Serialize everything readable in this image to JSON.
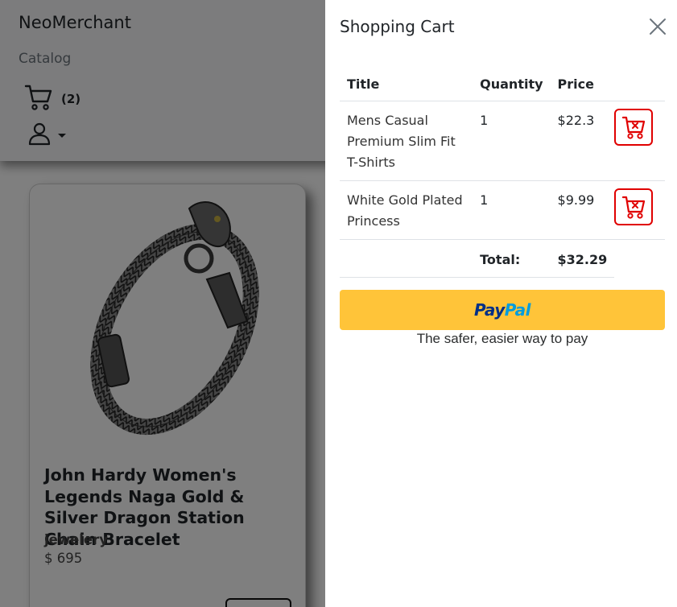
{
  "navbar": {
    "brand": "NeoMerchant",
    "catalog_link": "Catalog",
    "cart_count": "(2)",
    "cart_icon": "cart-icon",
    "user_icon": "user-icon"
  },
  "product": {
    "title": "John Hardy Women's Legends Naga Gold & Silver Dragon Station Chain Bracelet",
    "category": "jewelery",
    "price": "$ 695"
  },
  "cart": {
    "title": "Shopping Cart",
    "close_icon": "close-icon",
    "headers": {
      "title": "Title",
      "quantity": "Quantity",
      "price": "Price"
    },
    "items": [
      {
        "title": "Mens Casual Premium Slim Fit T-Shirts",
        "quantity": "1",
        "price": "$22.3",
        "remove_icon": "cart-remove-icon"
      },
      {
        "title": "White Gold Plated Princess",
        "quantity": "1",
        "price": "$9.99",
        "remove_icon": "cart-remove-icon"
      }
    ],
    "total_label": "Total:",
    "total_value": "$32.29",
    "paypal": {
      "brand_pay": "Pay",
      "brand_pal": "Pal",
      "tagline": "The safer, easier way to pay",
      "button_color": "#ffc439"
    },
    "accent_red": "#e00000"
  }
}
